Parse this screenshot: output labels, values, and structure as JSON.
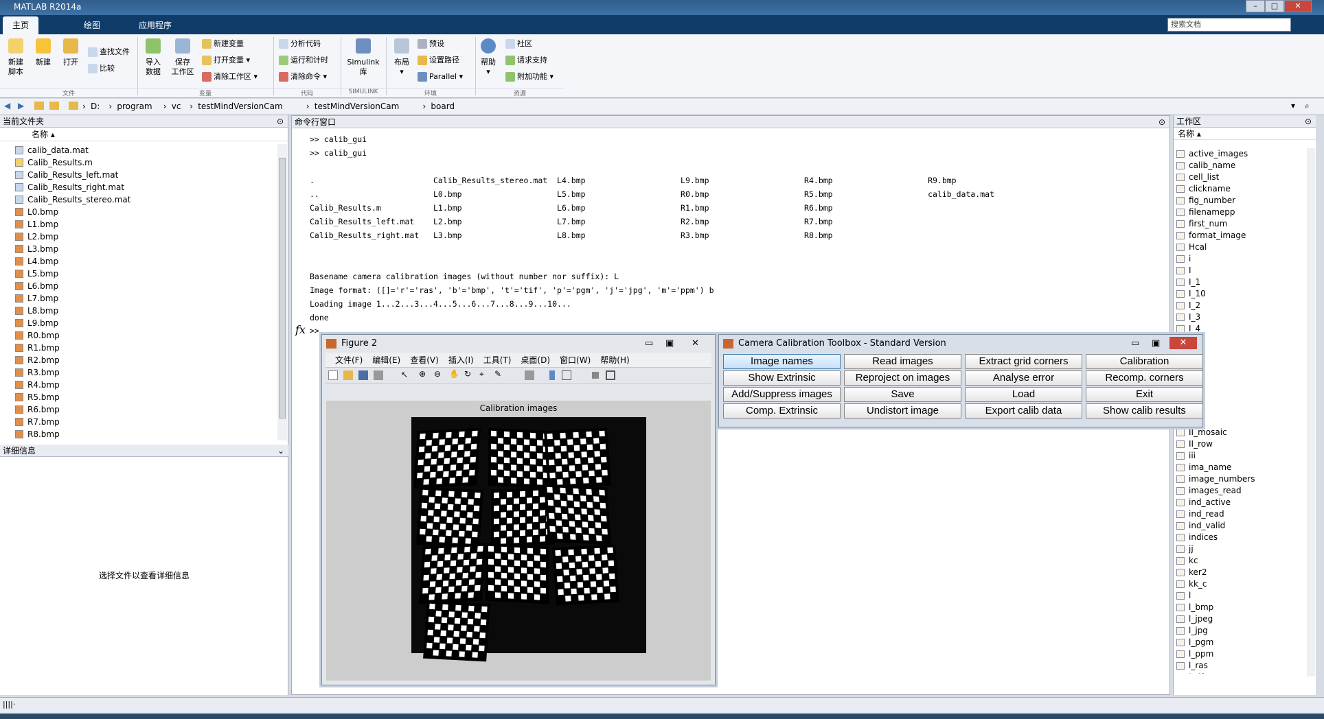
{
  "app": {
    "title": "MATLAB R2014a"
  },
  "tabs": [
    "主页",
    "绘图",
    "应用程序"
  ],
  "search": {
    "placeholder": "搜索文档"
  },
  "ribbon": {
    "big_buttons": [
      {
        "label": "新建\n脚本",
        "icon": "new-script-icon"
      },
      {
        "label": "新建",
        "icon": "new-icon"
      },
      {
        "label": "打开",
        "icon": "open-folder-icon"
      },
      {
        "label": "导入\n数据",
        "icon": "import-icon"
      },
      {
        "label": "保存\n工作区",
        "icon": "save-workspace-icon"
      },
      {
        "label": "Simulink\n库",
        "icon": "simulink-icon"
      },
      {
        "label": "布局",
        "icon": "layout-icon"
      },
      {
        "label": "帮助",
        "icon": "help-icon"
      }
    ],
    "small_buttons": [
      "查找文件",
      "比较",
      "新建变量",
      "打开变量",
      "清除工作区",
      "分析代码",
      "运行和计时",
      "清除命令",
      "预设",
      "设置路径",
      "Parallel",
      "社区",
      "请求支持",
      "附加功能"
    ],
    "groups": [
      "文件",
      "变量",
      "代码",
      "SIMULINK",
      "环境",
      "资源"
    ]
  },
  "path": [
    "D:",
    "program",
    "vc",
    "testMindVersionCam",
    "testMindVersionCam",
    "board"
  ],
  "current_folder": {
    "title": "当前文件夹",
    "column": "名称",
    "files": [
      "calib_data.mat",
      "Calib_Results.m",
      "Calib_Results_left.mat",
      "Calib_Results_right.mat",
      "Calib_Results_stereo.mat",
      "L0.bmp",
      "L1.bmp",
      "L2.bmp",
      "L3.bmp",
      "L4.bmp",
      "L5.bmp",
      "L6.bmp",
      "L7.bmp",
      "L8.bmp",
      "L9.bmp",
      "R0.bmp",
      "R1.bmp",
      "R2.bmp",
      "R3.bmp",
      "R4.bmp",
      "R5.bmp",
      "R6.bmp",
      "R7.bmp",
      "R8.bmp"
    ],
    "details_title": "详细信息",
    "details_hint": "选择文件以查看详细信息"
  },
  "command_window": {
    "title": "命令行窗口",
    "text": ">> calib_gui\n>> calib_gui\n\n.                         Calib_Results_stereo.mat  L4.bmp                    L9.bmp                    R4.bmp                    R9.bmp\n..                        L0.bmp                    L5.bmp                    R0.bmp                    R5.bmp                    calib_data.mat\nCalib_Results.m           L1.bmp                    L6.bmp                    R1.bmp                    R6.bmp\nCalib_Results_left.mat    L2.bmp                    L7.bmp                    R2.bmp                    R7.bmp\nCalib_Results_right.mat   L3.bmp                    L8.bmp                    R3.bmp                    R8.bmp\n\n\nBasename camera calibration images (without number nor suffix): L\nImage format: ([]='r'='ras', 'b'='bmp', 't'='tif', 'p'='pgm', 'j'='jpg', 'm'='ppm') b\nLoading image 1...2...3...4...5...6...7...8...9...10...\ndone",
    "prompt": ">>",
    "fx": "fx"
  },
  "workspace": {
    "title": "工作区",
    "column": "名称",
    "vars_top": [
      "active_images",
      "calib_name",
      "cell_list",
      "clickname",
      "fig_number",
      "filenamepp",
      "first_num",
      "format_image",
      "Hcal",
      "i",
      "I",
      "I_1",
      "I_10",
      "I_2",
      "I_3",
      "I_4"
    ],
    "vars_bottom": [
      "II_mosaic",
      "II_row",
      "iii",
      "ima_name",
      "image_numbers",
      "images_read",
      "ind_active",
      "ind_read",
      "ind_valid",
      "indices",
      "jj",
      "kc",
      "ker2",
      "kk_c",
      "l",
      "l_bmp",
      "l_jpeg",
      "l_jpg",
      "l_pgm",
      "l_ppm",
      "l_ras",
      "l_tif"
    ]
  },
  "figure2": {
    "title": "Figure 2",
    "menu": [
      "文件(F)",
      "编辑(E)",
      "查看(V)",
      "插入(I)",
      "工具(T)",
      "桌面(D)",
      "窗口(W)",
      "帮助(H)"
    ],
    "plot_title": "Calibration images"
  },
  "calib_toolbox": {
    "title": "Camera Calibration Toolbox - Standard Version",
    "buttons": [
      "Image names",
      "Read images",
      "Extract grid corners",
      "Calibration",
      "Show Extrinsic",
      "Reproject on images",
      "Analyse error",
      "Recomp. corners",
      "Add/Suppress images",
      "Save",
      "Load",
      "Exit",
      "Comp. Extrinsic",
      "Undistort image",
      "Export calib data",
      "Show calib results"
    ]
  }
}
